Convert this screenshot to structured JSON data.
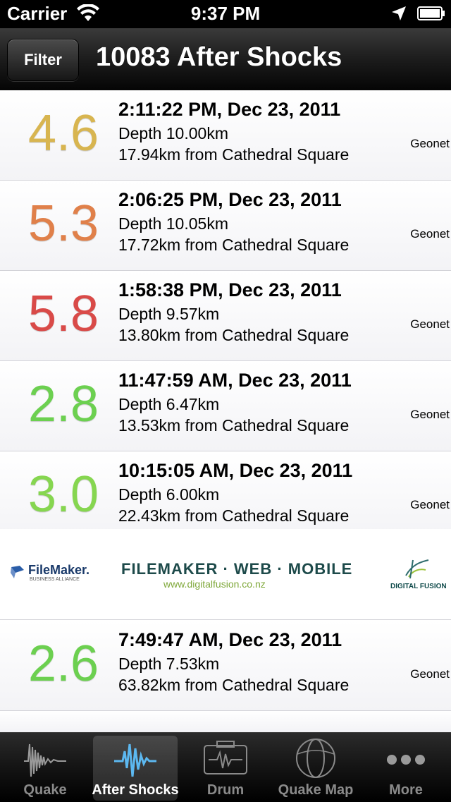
{
  "status_bar": {
    "carrier": "Carrier",
    "time": "9:37 PM",
    "icons": [
      "wifi-icon",
      "location-arrow-icon",
      "battery-icon"
    ]
  },
  "nav": {
    "filter_label": "Filter",
    "title": "10083 After Shocks"
  },
  "shocks": [
    {
      "magnitude": "4.6",
      "color": "#d8b550",
      "when": "2:11:22 PM, Dec 23, 2011",
      "depth": "Depth 10.00km",
      "distance": "17.94km from Cathedral Square",
      "source": "Geonet"
    },
    {
      "magnitude": "5.3",
      "color": "#e0804a",
      "when": "2:06:25 PM, Dec 23, 2011",
      "depth": "Depth 10.05km",
      "distance": "17.72km from Cathedral Square",
      "source": "Geonet"
    },
    {
      "magnitude": "5.8",
      "color": "#d94a48",
      "when": "1:58:38 PM, Dec 23, 2011",
      "depth": "Depth 9.57km",
      "distance": "13.80km from Cathedral Square",
      "source": "Geonet"
    },
    {
      "magnitude": "2.8",
      "color": "#6cd050",
      "when": "11:47:59 AM, Dec 23, 2011",
      "depth": "Depth 6.47km",
      "distance": "13.53km from Cathedral Square",
      "source": "Geonet"
    },
    {
      "magnitude": "3.0",
      "color": "#86d650",
      "when": "10:15:05 AM, Dec 23, 2011",
      "depth": "Depth 6.00km",
      "distance": "22.43km from Cathedral Square",
      "source": "Geonet"
    },
    {
      "magnitude": "2.6",
      "color": "#6cd050",
      "when": "7:49:47 AM, Dec 23, 2011",
      "depth": "Depth 7.53km",
      "distance": "63.82km from Cathedral Square",
      "source": "Geonet"
    }
  ],
  "ad": {
    "filemaker_name": "FileMaker.",
    "filemaker_sub": "BUSINESS ALLIANCE",
    "headline": "FILEMAKER · WEB · MOBILE",
    "url": "www.digitalfusion.co.nz",
    "partner": "DIGITAL FUSION"
  },
  "tabs": [
    {
      "label": "Quake",
      "icon": "seismogram-icon",
      "active": false
    },
    {
      "label": "After Shocks",
      "icon": "waveform-icon",
      "active": true
    },
    {
      "label": "Drum",
      "icon": "seismograph-drum-icon",
      "active": false
    },
    {
      "label": "Quake Map",
      "icon": "globe-icon",
      "active": false
    },
    {
      "label": "More",
      "icon": "more-dots-icon",
      "active": false
    }
  ]
}
